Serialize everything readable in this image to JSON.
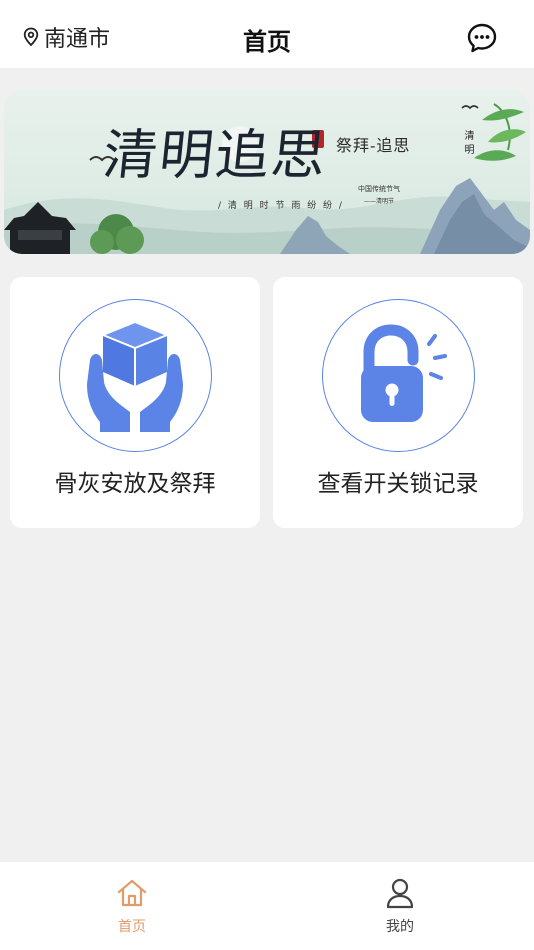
{
  "header": {
    "city": "南通市",
    "title": "首页"
  },
  "banner": {
    "title": "清明追思",
    "subtitle": "祭拜-追思",
    "small_text": "/ 清 明 时 节 雨 纷 纷 /",
    "vertical_text": "清明",
    "note_line1": "中国传统节气",
    "note_line2": "——清明节"
  },
  "cards": [
    {
      "label": "骨灰安放及祭拜",
      "icon": "box-in-hands-icon"
    },
    {
      "label": "查看开关锁记录",
      "icon": "unlock-icon"
    }
  ],
  "tabbar": {
    "items": [
      {
        "label": "首页",
        "icon": "home-icon",
        "active": true
      },
      {
        "label": "我的",
        "icon": "user-icon",
        "active": false
      }
    ]
  },
  "colors": {
    "accent": "#5b84e6",
    "active_tab": "#e29b6b",
    "background": "#f0f0f0"
  }
}
